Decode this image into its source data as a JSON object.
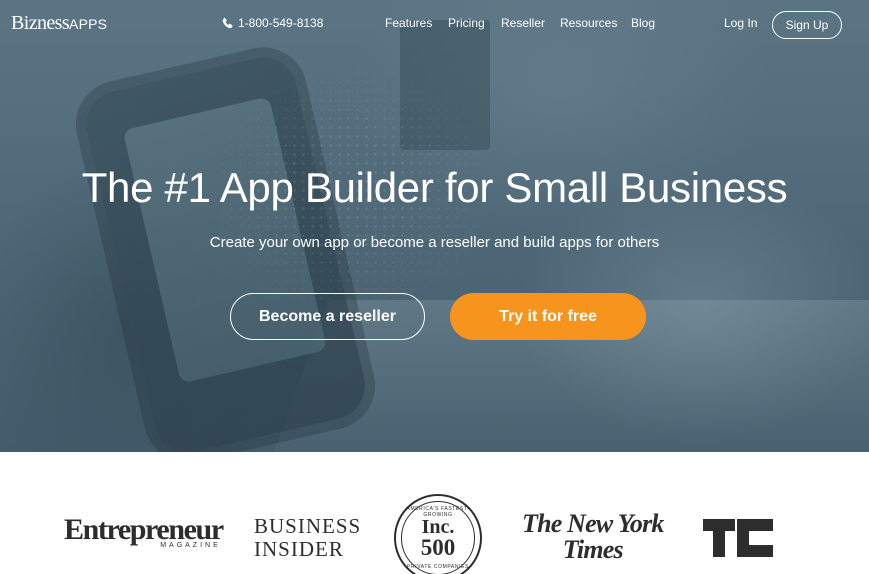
{
  "colors": {
    "hero_overlay": "#4e6776",
    "primary_cta": "#f7941d",
    "text_light": "#ffffff",
    "press_logo": "#2d2d2d"
  },
  "nav": {
    "logo_main": "Bizness",
    "logo_accent": "APPS",
    "phone": "1-800-549-8138",
    "phone_icon": "phone-icon",
    "links": [
      "Features",
      "Pricing",
      "Reseller",
      "Resources",
      "Blog"
    ],
    "login": "Log In",
    "signup": "Sign Up"
  },
  "hero": {
    "headline": "The #1 App Builder for Small Business",
    "subheadline": "Create your own app or become a reseller and build apps for others",
    "secondary_cta": "Become a reseller",
    "primary_cta": "Try it for free"
  },
  "press": {
    "entrepreneur": {
      "main": "Entrepreneur",
      "sub": "MAGAZINE"
    },
    "business_insider": {
      "line1": "BUSINESS",
      "line2": "INSIDER"
    },
    "inc": {
      "arc_top": "AMERICA'S FASTEST-GROWING",
      "word": "Inc.",
      "number": "500",
      "arc_bottom": "PRIVATE COMPANIES"
    },
    "nyt": {
      "line1": "The New York",
      "line2": "Times"
    },
    "techcrunch": "techcrunch-logo"
  }
}
